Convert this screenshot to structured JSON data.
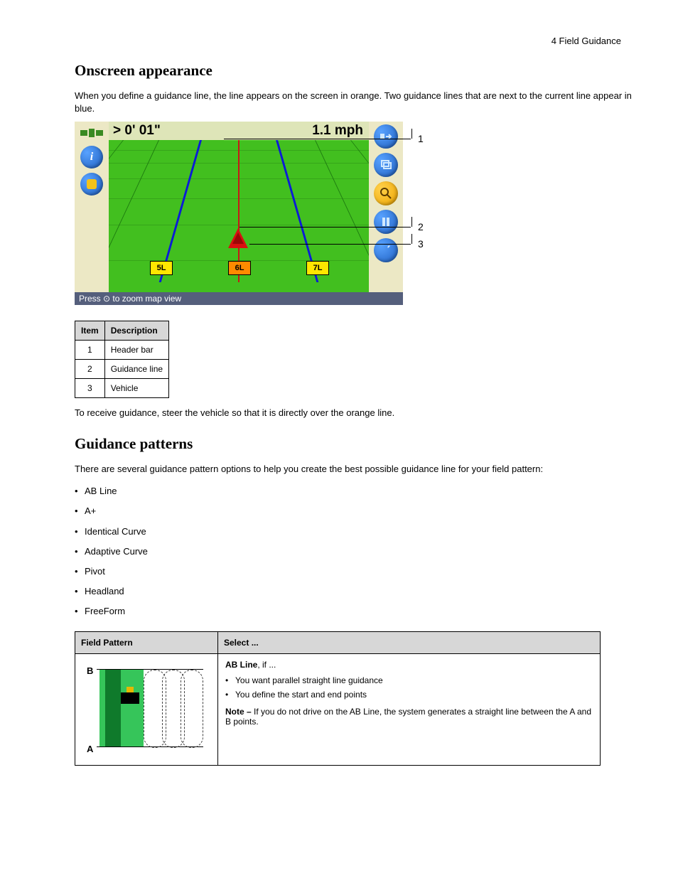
{
  "topRight": "4     Field Guidance",
  "h_onscreen": "Onscreen appearance",
  "p_onscreen": "When you define a guidance line, the line appears on the screen in orange. Two guidance lines that are next to the current line appear in blue.",
  "shot": {
    "distance": "> 0' 01\"",
    "speed": "1.1 mph",
    "swaths": {
      "l": "5L",
      "c": "6L",
      "r": "7L"
    },
    "status": "Press ⊙ to zoom map view",
    "icons": {
      "sat": "satellite-icon",
      "info": "info-icon",
      "user": "operator-icon",
      "map": "map-action-icon",
      "layers": "layers-icon",
      "zoom": "zoom-icon",
      "pause": "pause-icon",
      "wrench": "settings-icon"
    }
  },
  "legend": {
    "h1": "Item",
    "h2": "Description",
    "rows": [
      {
        "n": "1",
        "d": "Header bar"
      },
      {
        "n": "2",
        "d": "Guidance line"
      },
      {
        "n": "3",
        "d": "Vehicle"
      }
    ]
  },
  "p_steer": "To receive guidance, steer the vehicle so that it is directly over the orange line.",
  "h_patterns": "Guidance patterns",
  "p_patterns_intro": "There are several guidance pattern options to help you create the best possible guidance line for your field pattern:",
  "patterns_list": [
    "AB Line",
    "A+",
    "Identical Curve",
    "Adaptive Curve",
    "Pivot",
    "Headland",
    "FreeForm"
  ],
  "pat_table": {
    "h1": "Field Pattern",
    "h2": "Select ...",
    "row1": {
      "name": "AB Line",
      "line": ", if ...",
      "bullets": [
        "You want parallel straight line guidance",
        "You define the start and end points"
      ],
      "note_label": "Note –",
      "note": "If you do not drive on the AB Line, the system generates a straight line between the A and B points."
    }
  }
}
